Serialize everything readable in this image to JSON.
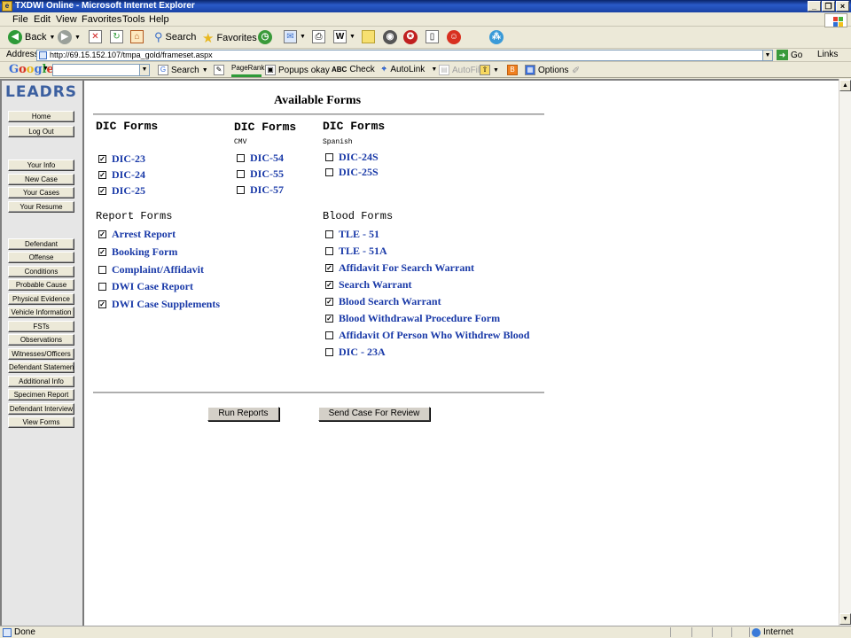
{
  "window": {
    "title": "TXDWI Online - Microsoft Internet Explorer",
    "controls": [
      "_",
      "❐",
      "×"
    ]
  },
  "menu": [
    "File",
    "Edit",
    "View",
    "Favorites",
    "Tools",
    "Help"
  ],
  "toolbar": {
    "back": "Back",
    "search": "Search",
    "favorites": "Favorites"
  },
  "address": {
    "label": "Address",
    "url": "http://69.15.152.107/tmpa_gold/frameset.aspx",
    "go": "Go",
    "links": "Links"
  },
  "google": {
    "logo": "Google",
    "search": "Search",
    "pagerank": "PageRank",
    "popups": "Popups okay",
    "check": "Check",
    "autolink": "AutoLink",
    "autofill": "AutoFill",
    "options": "Options"
  },
  "sidebar": {
    "logo": "LEADRS",
    "items": [
      "Home",
      "Log Out",
      "Your Info",
      "New Case",
      "Your Cases",
      "Your Resume",
      "Defendant",
      "Offense",
      "Conditions",
      "Probable Cause",
      "Physical Evidence",
      "Vehicle Information",
      "FSTs",
      "Observations",
      "Witnesses/Officers",
      "Defendant Statement",
      "Additional Info",
      "Specimen Report",
      "Defendant Interview",
      "View Forms"
    ]
  },
  "page": {
    "title": "Available Forms",
    "sections": {
      "dic": {
        "heading": "DIC Forms",
        "items": [
          {
            "label": "DIC-23",
            "checked": true
          },
          {
            "label": "DIC-24",
            "checked": true
          },
          {
            "label": "DIC-25",
            "checked": true
          }
        ]
      },
      "dic_cmv": {
        "heading": "DIC Forms",
        "sub": "CMV",
        "items": [
          {
            "label": "DIC-54",
            "checked": false
          },
          {
            "label": "DIC-55",
            "checked": false
          },
          {
            "label": "DIC-57",
            "checked": false
          }
        ]
      },
      "dic_spanish": {
        "heading": "DIC Forms",
        "sub": "Spanish",
        "items": [
          {
            "label": "DIC-24S",
            "checked": false
          },
          {
            "label": "DIC-25S",
            "checked": false
          }
        ]
      },
      "report": {
        "heading": "Report Forms",
        "items": [
          {
            "label": "Arrest Report",
            "checked": true
          },
          {
            "label": "Booking Form",
            "checked": true
          },
          {
            "label": "Complaint/Affidavit",
            "checked": false
          },
          {
            "label": "DWI Case Report",
            "checked": false
          },
          {
            "label": "DWI Case Supplements",
            "checked": true
          }
        ]
      },
      "blood": {
        "heading": "Blood Forms",
        "items": [
          {
            "label": "TLE - 51",
            "checked": false
          },
          {
            "label": "TLE - 51A",
            "checked": false
          },
          {
            "label": "Affidavit For Search Warrant",
            "checked": true
          },
          {
            "label": "Search Warrant",
            "checked": true
          },
          {
            "label": "Blood Search Warrant",
            "checked": true
          },
          {
            "label": "Blood Withdrawal Procedure Form",
            "checked": true
          },
          {
            "label": "Affidavit Of Person Who Withdrew Blood",
            "checked": false
          },
          {
            "label": "DIC - 23A",
            "checked": false
          }
        ]
      }
    },
    "buttons": {
      "run": "Run Reports",
      "send": "Send Case For Review"
    }
  },
  "status": {
    "text": "Done",
    "zone": "Internet"
  },
  "colors": {
    "link": "#1a3aa8",
    "titlebar": "#0a246a",
    "logo": "#3b5fa0"
  }
}
